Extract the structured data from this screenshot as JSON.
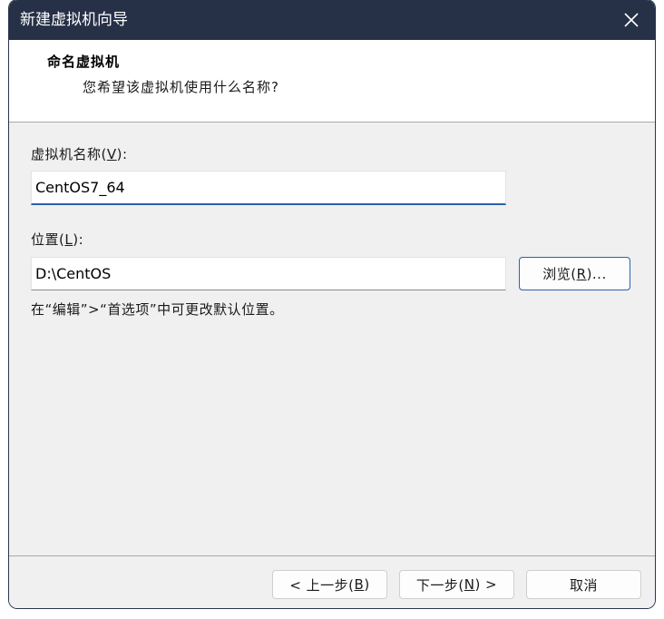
{
  "window": {
    "title": "新建虚拟机向导"
  },
  "header": {
    "title": "命名虚拟机",
    "subtitle": "您希望该虚拟机使用什么名称?"
  },
  "form": {
    "name_label_pre": "虚拟机名称(",
    "name_label_key": "V",
    "name_label_post": "):",
    "name_value": "CentOS7_64",
    "location_label_pre": "位置(",
    "location_label_key": "L",
    "location_label_post": "):",
    "location_value": "D:\\CentOS",
    "browse_pre": "浏览(",
    "browse_key": "R",
    "browse_post": ")...",
    "hint": "在“编辑”>“首选项”中可更改默认位置。"
  },
  "footer": {
    "back_pre": "< 上一步(",
    "back_key": "B",
    "back_post": ")",
    "next_pre": "下一步(",
    "next_key": "N",
    "next_post": ") >",
    "cancel_label": "取消"
  },
  "colors": {
    "titlebar": "#263047",
    "accent": "#2a62a8"
  }
}
